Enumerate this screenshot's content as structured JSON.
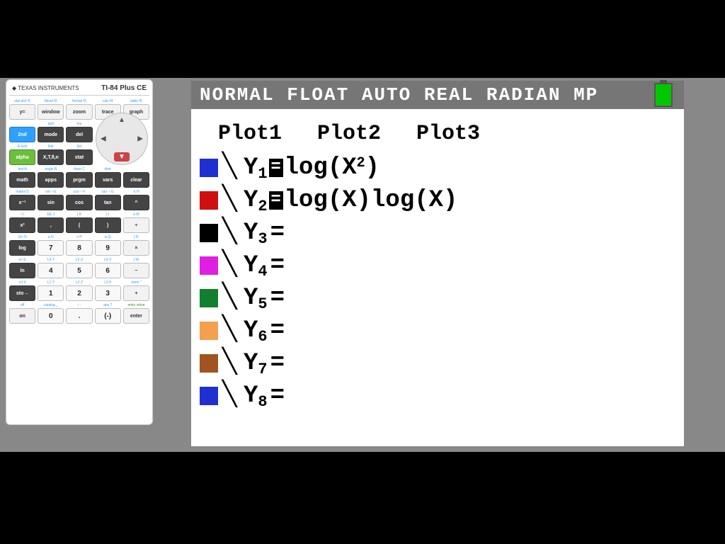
{
  "calculator": {
    "brand": "TEXAS INSTRUMENTS",
    "model": "TI-84 Plus CE",
    "rows": {
      "r1_sec": [
        "stat plot f1",
        "tblset f2",
        "format f3",
        "calc f4",
        "table f5"
      ],
      "r1": [
        "y=",
        "window",
        "zoom",
        "trace",
        "graph"
      ],
      "r2_sec": [
        "",
        "quit",
        "ins",
        "",
        ""
      ],
      "r2": [
        "2nd",
        "mode",
        "del"
      ],
      "r3_sec": [
        "A-lock",
        "link",
        "list",
        "",
        ""
      ],
      "r3": [
        "alpha",
        "X,T,θ,n",
        "stat"
      ],
      "r4_sec": [
        "test A",
        "angle B",
        "draw C",
        "distr",
        ""
      ],
      "r4": [
        "math",
        "apps",
        "prgm",
        "vars",
        "clear"
      ],
      "r5_sec": [
        "matrix D",
        "sin⁻¹ E",
        "cos⁻¹ F",
        "tan⁻¹ G",
        "π H"
      ],
      "r5": [
        "x⁻¹",
        "sin",
        "cos",
        "tan",
        "^"
      ],
      "r6_sec": [
        "√ I",
        "EE J",
        "{ K",
        "} L",
        "e M"
      ],
      "r6": [
        "x²",
        ",",
        "(",
        ")",
        "÷"
      ],
      "r7_sec": [
        "10ˣ N",
        "u O",
        "v P",
        "w Q",
        "[ R"
      ],
      "r7": [
        "log",
        "7",
        "8",
        "9",
        "×"
      ],
      "r8_sec": [
        "eˣ S",
        "L4 T",
        "L5 U",
        "L6 V",
        "] W"
      ],
      "r8": [
        "ln",
        "4",
        "5",
        "6",
        "−"
      ],
      "r9_sec": [
        "rcl X",
        "L1 Y",
        "L2 Z",
        "L3 θ",
        "mem \""
      ],
      "r9": [
        "sto→",
        "1",
        "2",
        "3",
        "+"
      ],
      "r10_sec": [
        "off",
        "catalog _",
        "i :",
        "ans ?",
        "entry solve"
      ],
      "r10": [
        "on",
        "0",
        ".",
        "(-)",
        "enter"
      ]
    }
  },
  "screen": {
    "status": "NORMAL FLOAT AUTO REAL RADIAN MP",
    "plots": [
      "Plot1",
      "Plot2",
      "Plot3"
    ],
    "functions": [
      {
        "idx": "1",
        "color": "#2030d0",
        "expr_html": "log(X<span class='sup'>2</span>)",
        "filled": true
      },
      {
        "idx": "2",
        "color": "#d01010",
        "expr_html": "log(X)log(X)",
        "filled": true
      },
      {
        "idx": "3",
        "color": "#000000",
        "expr_html": "",
        "filled": false
      },
      {
        "idx": "4",
        "color": "#e020e0",
        "expr_html": "",
        "filled": false
      },
      {
        "idx": "5",
        "color": "#108030",
        "expr_html": "",
        "filled": false
      },
      {
        "idx": "6",
        "color": "#f5a050",
        "expr_html": "",
        "filled": false
      },
      {
        "idx": "7",
        "color": "#a05520",
        "expr_html": "",
        "filled": false
      },
      {
        "idx": "8",
        "color": "#2030d0",
        "expr_html": "",
        "filled": false
      }
    ]
  }
}
